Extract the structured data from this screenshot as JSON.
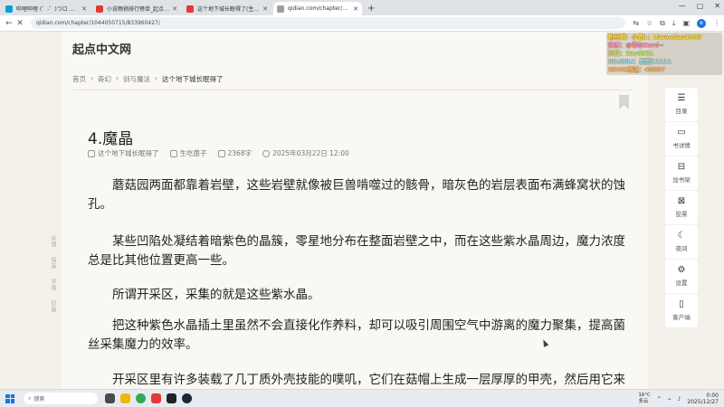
{
  "browser": {
    "tabs": [
      {
        "label": "哔哩哔哩 (゜-゜)つロ 干杯~-bilibili",
        "fav_color": "#00a1d6"
      },
      {
        "label": "小说畅销排行榜单_起点小说网",
        "fav_color": "#e53935"
      },
      {
        "label": "这个地下城长眠得了(生吃菌子)",
        "fav_color": "#e53935"
      },
      {
        "label": "qidian.com/chapter/10440571",
        "fav_color": "#9e9e9e"
      }
    ],
    "new_tab": "+",
    "url": "qidian.com/chapter/1044050715/833960427/"
  },
  "site": {
    "logo": "起点中文网",
    "breadcrumb": [
      "首页",
      "奇幻",
      "剑与魔法",
      "这个地下城长眠得了"
    ]
  },
  "chapter": {
    "title": "4.魔晶",
    "book": "这个地下城长眠得了",
    "author": "生吃菌子",
    "word_count": "2368字",
    "date": "2025年03月22日 12:00",
    "paragraphs": [
      "蘑菇园两面都靠着岩壁，这些岩壁就像被巨兽啃噬过的骸骨，暗灰色的岩层表面布满蜂窝状的蚀孔。",
      "某些凹陷处凝结着暗紫色的晶簇，零星地分布在整面岩壁之中，而在这些紫水晶周边，魔力浓度总是比其他位置更高一些。",
      "所谓开采区，采集的就是这些紫水晶。",
      "把这种紫色水晶插土里虽然不会直接化作养料，却可以吸引周围空气中游离的魔力聚集，提高菌丝采集魔力的效率。",
      "开采区里有许多装载了几丁质外壳技能的噗叽，它们在菇帽上生成一层厚厚的甲壳，然后用它来"
    ]
  },
  "sidelinks": [
    "反馈",
    "指南",
    "举报",
    "旧版"
  ],
  "tools": [
    {
      "label": "目录",
      "icon": "☰",
      "name": "catalog"
    },
    {
      "label": "书详情",
      "icon": "▭",
      "name": "book-details"
    },
    {
      "label": "加书架",
      "icon": "⊟",
      "name": "add-shelf"
    },
    {
      "label": "投票",
      "icon": "⊠",
      "name": "vote"
    },
    {
      "label": "夜间",
      "icon": "☾",
      "name": "night-mode"
    },
    {
      "label": "设置",
      "icon": "⚙",
      "name": "settings"
    },
    {
      "label": "客户端",
      "icon": "▯",
      "name": "client"
    }
  ],
  "overlay": [
    {
      "text": "粉丝群：小鹿1：Liwandao1995",
      "style": "yellow"
    },
    {
      "text": "微博：@菲尔Zard~",
      "style": "pink"
    },
    {
      "text": "抖音：Zard921",
      "style": "green"
    },
    {
      "text": "BILIBILI：鹿鹿11111",
      "style": "cyan"
    },
    {
      "text": "KOOK频道：40937",
      "style": "orange"
    }
  ],
  "taskbar": {
    "search_placeholder": "搜索",
    "weather_temp": "16°C",
    "weather_desc": "多云",
    "time": "0:00",
    "date": "2025/12/27"
  }
}
